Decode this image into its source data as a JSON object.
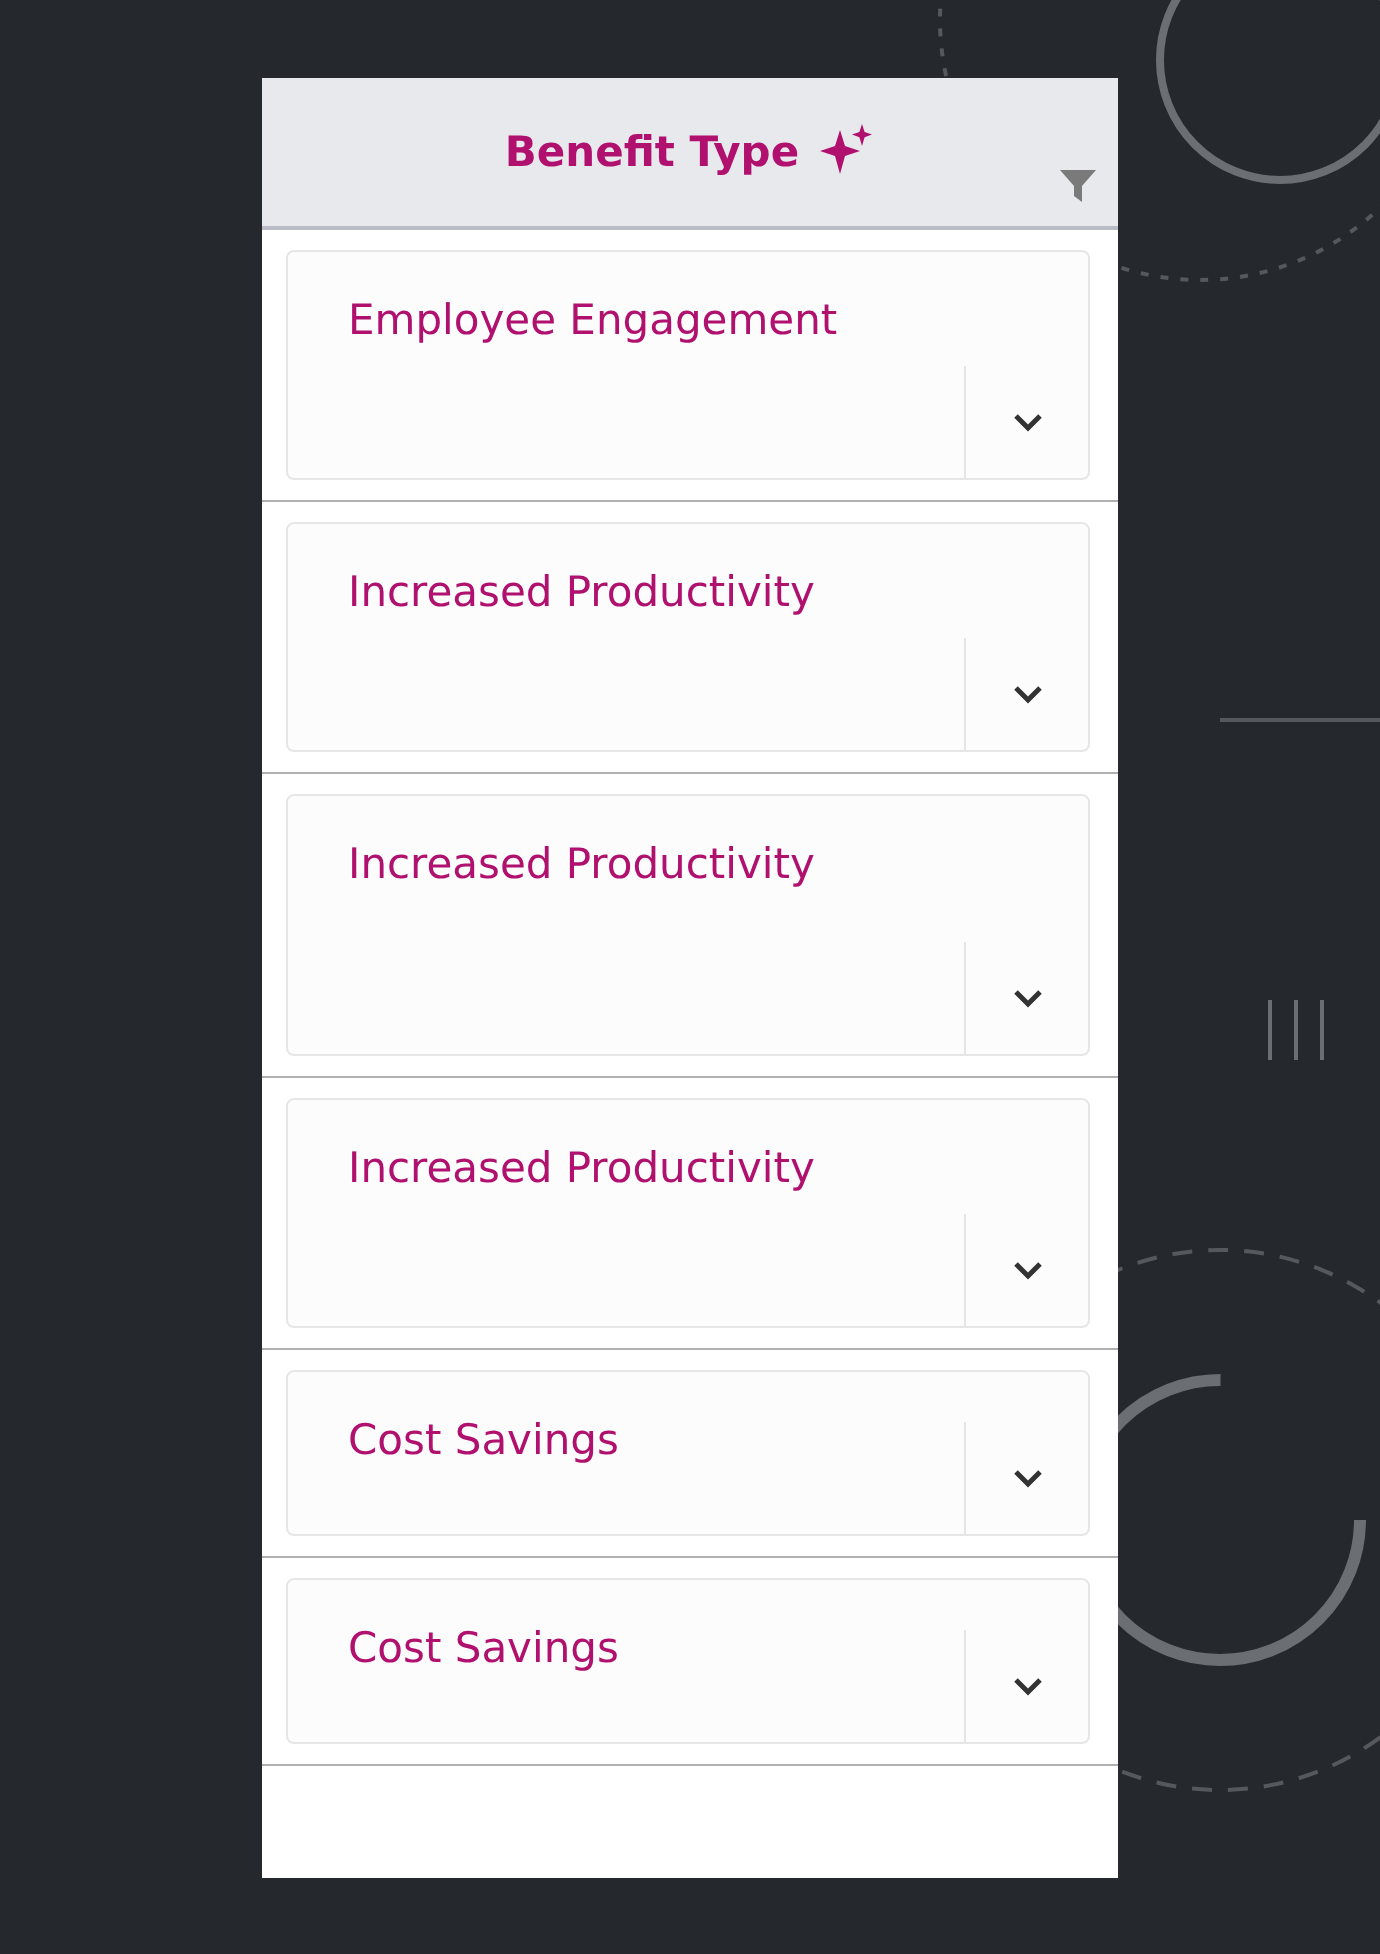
{
  "header": {
    "title": "Benefit Type"
  },
  "rows": [
    {
      "label": "Employee Engagement"
    },
    {
      "label": "Increased Productivity"
    },
    {
      "label": "Increased Productivity"
    },
    {
      "label": "Increased Productivity"
    },
    {
      "label": "Cost Savings"
    },
    {
      "label": "Cost Savings"
    }
  ]
}
